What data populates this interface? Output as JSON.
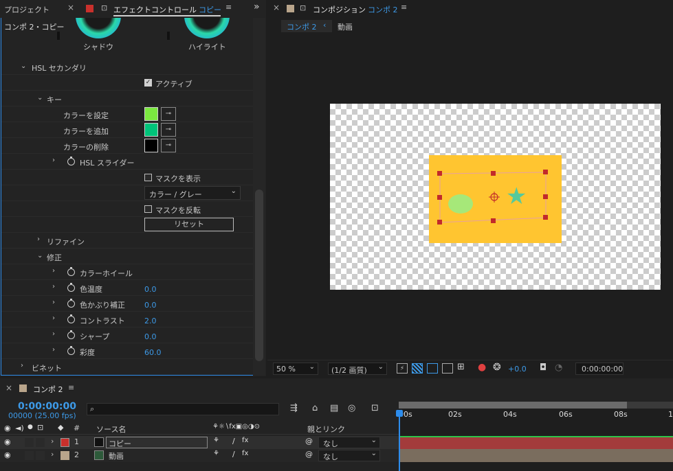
{
  "left_panel": {
    "tab_project": "プロジェクト",
    "tab_effect": "エフェクトコントロール",
    "tab_effect_target": "コピー",
    "breadcrumb": "コンポ 2・コピー",
    "wheel_shadow": "シャドウ",
    "wheel_highlight": "ハイライト",
    "hsl_secondary": "HSL セカンダリ",
    "active_label": "アクティブ",
    "key": "キー",
    "set_color": "カラーを設定",
    "add_color": "カラーを追加",
    "remove_color": "カラーの削除",
    "hsl_slider": "HSL スライダー",
    "show_mask": "マスクを表示",
    "mask_mode": "カラー / グレー",
    "invert_mask": "マスクを反転",
    "reset": "リセット",
    "refine": "リファイン",
    "correction": "修正",
    "color_wheel": "カラーホイール",
    "temperature": "色温度",
    "temperature_val": "0.0",
    "tint": "色かぶり補正",
    "tint_val": "0.0",
    "contrast": "コントラスト",
    "contrast_val": "2.0",
    "sharpen": "シャープ",
    "sharpen_val": "0.0",
    "saturation": "彩度",
    "saturation_val": "60.0",
    "vignette": "ビネット",
    "colors": {
      "set": "#7be840",
      "add": "#00c47a",
      "remove": "#000000"
    }
  },
  "composition": {
    "title": "コンポジション",
    "name": "コンポ 2",
    "tab_active": "コンポ 2",
    "tab_other": "動画",
    "zoom": "50 %",
    "quality": "(1/2 画質)",
    "exposure": "+0.0",
    "timecode": "0:00:00:00"
  },
  "timeline": {
    "comp_tab": "コンポ 2",
    "current_time": "0:00:00:00",
    "frame_info": "00000 (25.00 fps)",
    "col_source": "ソース名",
    "col_parent": "親とリンク",
    "col_hash": "#",
    "ruler": [
      "00s",
      "02s",
      "04s",
      "06s",
      "08s",
      "1"
    ],
    "layers": [
      {
        "num": "1",
        "name": "コピー",
        "parent": "なし"
      },
      {
        "num": "2",
        "name": "動画",
        "parent": "なし"
      }
    ]
  }
}
